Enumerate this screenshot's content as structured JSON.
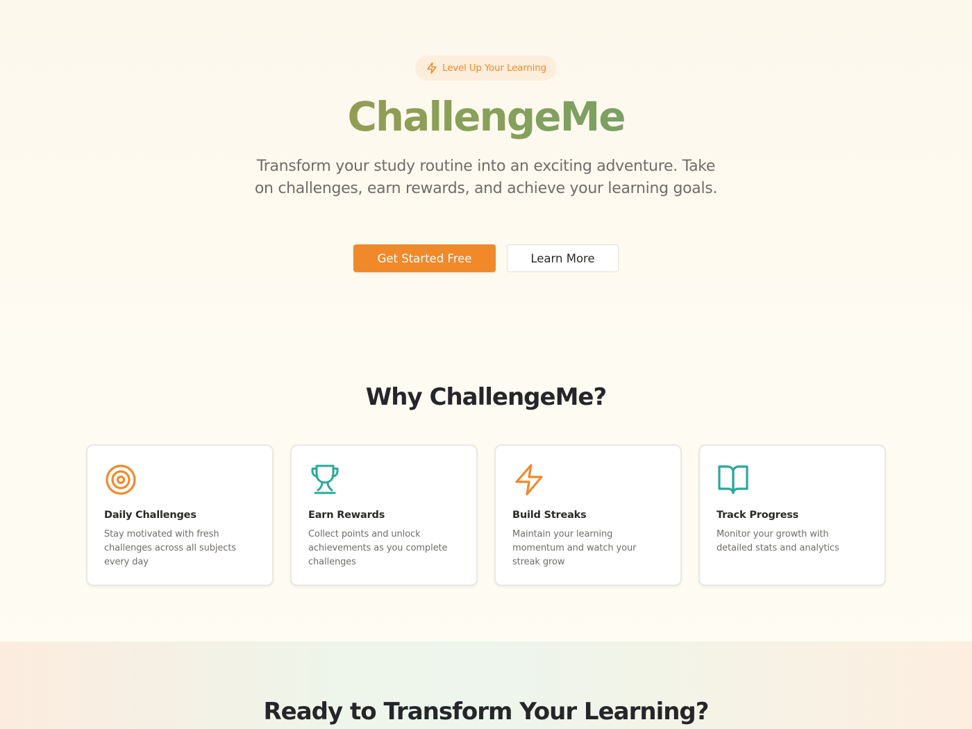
{
  "hero": {
    "badge": {
      "icon": "lightning-icon",
      "label": "Level Up Your Learning"
    },
    "title": "ChallengeMe",
    "subtitle": "Transform your study routine into an exciting adventure. Take on challenges, earn rewards, and achieve your learning goals.",
    "primary_button": "Get Started Free",
    "secondary_button": "Learn More"
  },
  "features": {
    "heading": "Why ChallengeMe?",
    "cards": [
      {
        "icon": "target-icon",
        "title": "Daily Challenges",
        "description": "Stay motivated with fresh challenges across all subjects every day"
      },
      {
        "icon": "trophy-icon",
        "title": "Earn Rewards",
        "description": "Collect points and unlock achievements as you complete challenges"
      },
      {
        "icon": "lightning-icon",
        "title": "Build Streaks",
        "description": "Maintain your learning momentum and watch your streak grow"
      },
      {
        "icon": "book-icon",
        "title": "Track Progress",
        "description": "Monitor your growth with detailed stats and analytics"
      }
    ]
  },
  "cta": {
    "heading": "Ready to Transform Your Learning?"
  },
  "colors": {
    "accent_orange": "#f0892a",
    "accent_teal": "#2aa89a",
    "title_gradient_start": "#ad9544",
    "title_gradient_end": "#55a282"
  }
}
